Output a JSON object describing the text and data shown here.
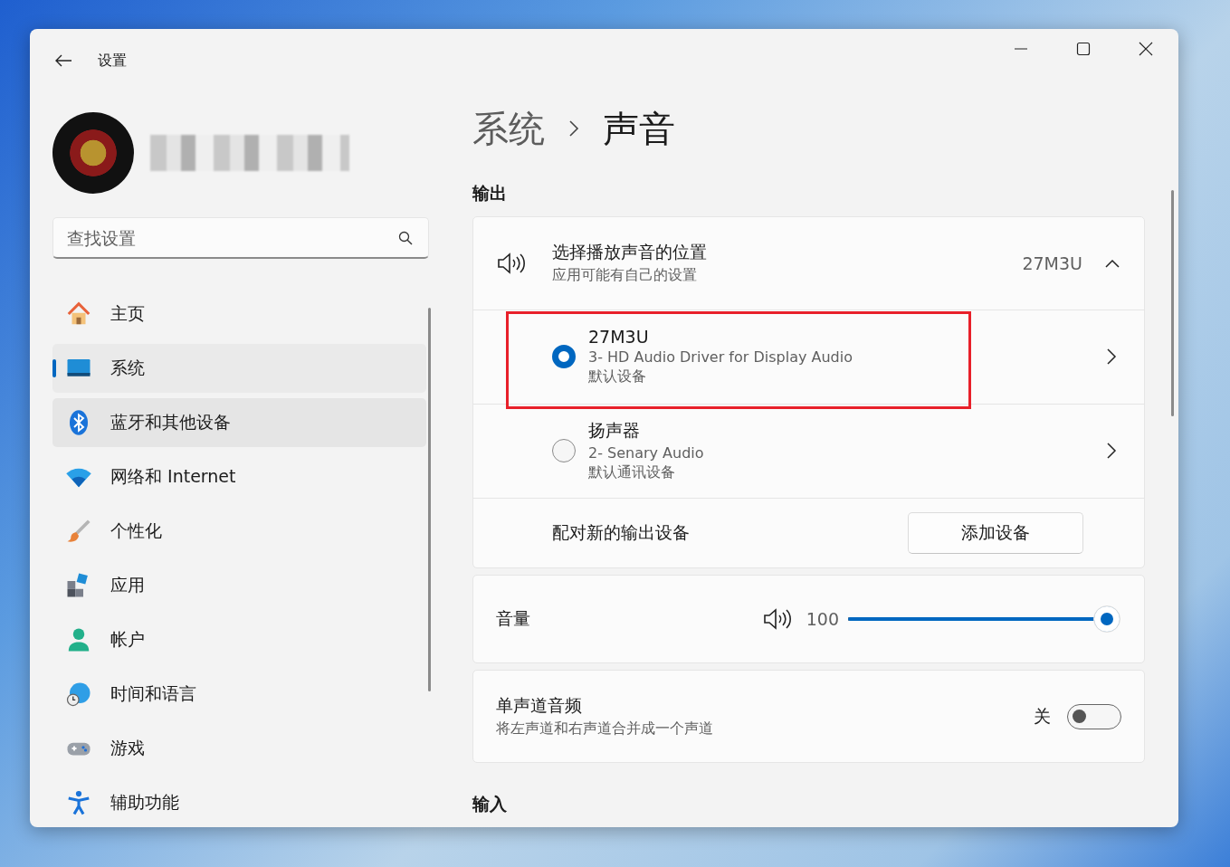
{
  "window": {
    "title": "设置"
  },
  "search": {
    "placeholder": "查找设置"
  },
  "nav": [
    {
      "label": "主页",
      "selected": false,
      "hovered": false
    },
    {
      "label": "系统",
      "selected": true,
      "hovered": false
    },
    {
      "label": "蓝牙和其他设备",
      "selected": false,
      "hovered": true
    },
    {
      "label": "网络和 Internet",
      "selected": false,
      "hovered": false
    },
    {
      "label": "个性化",
      "selected": false,
      "hovered": false
    },
    {
      "label": "应用",
      "selected": false,
      "hovered": false
    },
    {
      "label": "帐户",
      "selected": false,
      "hovered": false
    },
    {
      "label": "时间和语言",
      "selected": false,
      "hovered": false
    },
    {
      "label": "游戏",
      "selected": false,
      "hovered": false
    },
    {
      "label": "辅助功能",
      "selected": false,
      "hovered": false
    }
  ],
  "breadcrumb": {
    "parent": "系统",
    "current": "声音"
  },
  "output": {
    "heading": "输出",
    "selector": {
      "title": "选择播放声音的位置",
      "subtitle": "应用可能有自己的设置",
      "value": "27M3U",
      "expanded": true
    },
    "devices": [
      {
        "name": "27M3U",
        "driver": "3- HD Audio Driver for Display Audio",
        "role": "默认设备",
        "selected": true,
        "highlighted": true
      },
      {
        "name": "扬声器",
        "driver": "2- Senary Audio",
        "role": "默认通讯设备",
        "selected": false,
        "highlighted": false
      }
    ],
    "pair": {
      "label": "配对新的输出设备",
      "button": "添加设备"
    }
  },
  "volume": {
    "label": "音量",
    "reading": "100",
    "level": 1
  },
  "mono": {
    "title": "单声道音频",
    "subtitle": "将左声道和右声道合并成一个声道",
    "state_label": "关",
    "on": false
  },
  "input": {
    "heading": "输入"
  }
}
